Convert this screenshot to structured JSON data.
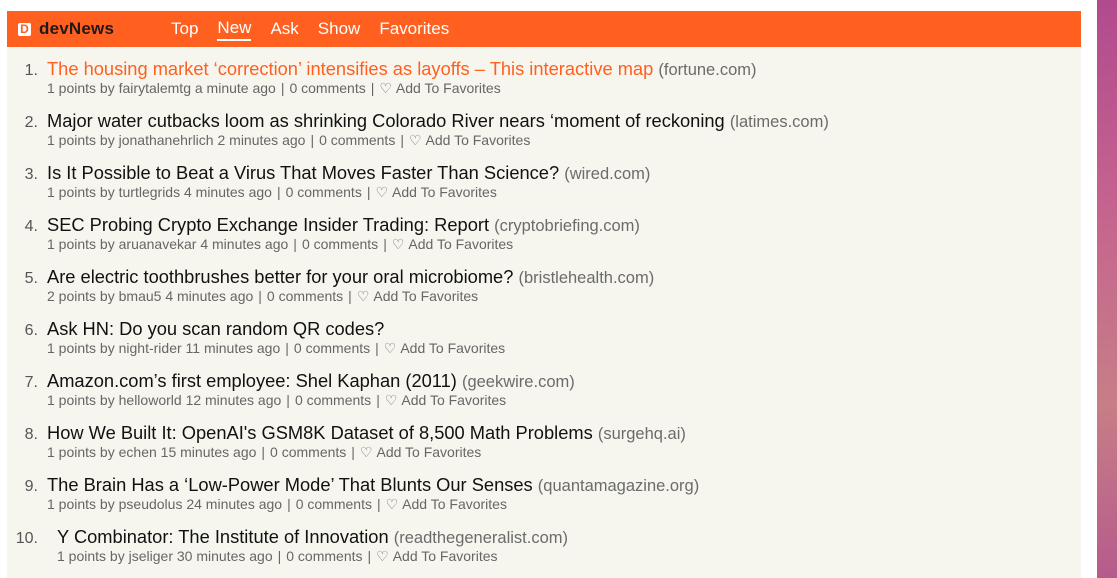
{
  "colors": {
    "brand": "#ff5f1f",
    "background": "#f6f6ef",
    "visited_title": "#ff5f1f"
  },
  "header": {
    "logo_letter": "D",
    "site_name": "devNews",
    "nav": [
      "Top",
      "New",
      "Ask",
      "Show",
      "Favorites"
    ],
    "active_nav": "New"
  },
  "separator": "|",
  "favorite_label": "Add To Favorites",
  "heart_icon": "♡",
  "stories": [
    {
      "rank": "1.",
      "title": "The housing market ‘correction’ intensifies as layoffs – This interactive map",
      "domain": "(fortune.com)",
      "points": "1 points",
      "author": "fairytalemtg",
      "time": "a minute ago",
      "comments": "0 comments"
    },
    {
      "rank": "2.",
      "title": "Major water cutbacks loom as shrinking Colorado River nears ‘moment of reckoning",
      "domain": "(latimes.com)",
      "points": "1 points",
      "author": "jonathanehrlich",
      "time": "2 minutes ago",
      "comments": "0 comments"
    },
    {
      "rank": "3.",
      "title": "Is It Possible to Beat a Virus That Moves Faster Than Science?",
      "domain": "(wired.com)",
      "points": "1 points",
      "author": "turtlegrids",
      "time": "4 minutes ago",
      "comments": "0 comments"
    },
    {
      "rank": "4.",
      "title": "SEC Probing Crypto Exchange Insider Trading: Report",
      "domain": "(cryptobriefing.com)",
      "points": "1 points",
      "author": "aruanavekar",
      "time": "4 minutes ago",
      "comments": "0 comments"
    },
    {
      "rank": "5.",
      "title": "Are electric toothbrushes better for your oral microbiome?",
      "domain": "(bristlehealth.com)",
      "points": "2 points",
      "author": "bmau5",
      "time": "4 minutes ago",
      "comments": "0 comments"
    },
    {
      "rank": "6.",
      "title": "Ask HN: Do you scan random QR codes?",
      "domain": "",
      "points": "1 points",
      "author": "night-rider",
      "time": "11 minutes ago",
      "comments": "0 comments"
    },
    {
      "rank": "7.",
      "title": "Amazon.com’s first employee: Shel Kaphan (2011)",
      "domain": "(geekwire.com)",
      "points": "1 points",
      "author": "helloworld",
      "time": "12 minutes ago",
      "comments": "0 comments"
    },
    {
      "rank": "8.",
      "title": "How We Built It: OpenAI's GSM8K Dataset of 8,500 Math Problems",
      "domain": "(surgehq.ai)",
      "points": "1 points",
      "author": "echen",
      "time": "15 minutes ago",
      "comments": "0 comments"
    },
    {
      "rank": "9.",
      "title": "The Brain Has a ‘Low-Power Mode’ That Blunts Our Senses",
      "domain": "(quantamagazine.org)",
      "points": "1 points",
      "author": "pseudolus",
      "time": "24 minutes ago",
      "comments": "0 comments"
    },
    {
      "rank": "10.",
      "title": "Y Combinator: The Institute of Innovation",
      "domain": "(readthegeneralist.com)",
      "points": "1 points",
      "author": "jseliger",
      "time": "30 minutes ago",
      "comments": "0 comments"
    }
  ]
}
